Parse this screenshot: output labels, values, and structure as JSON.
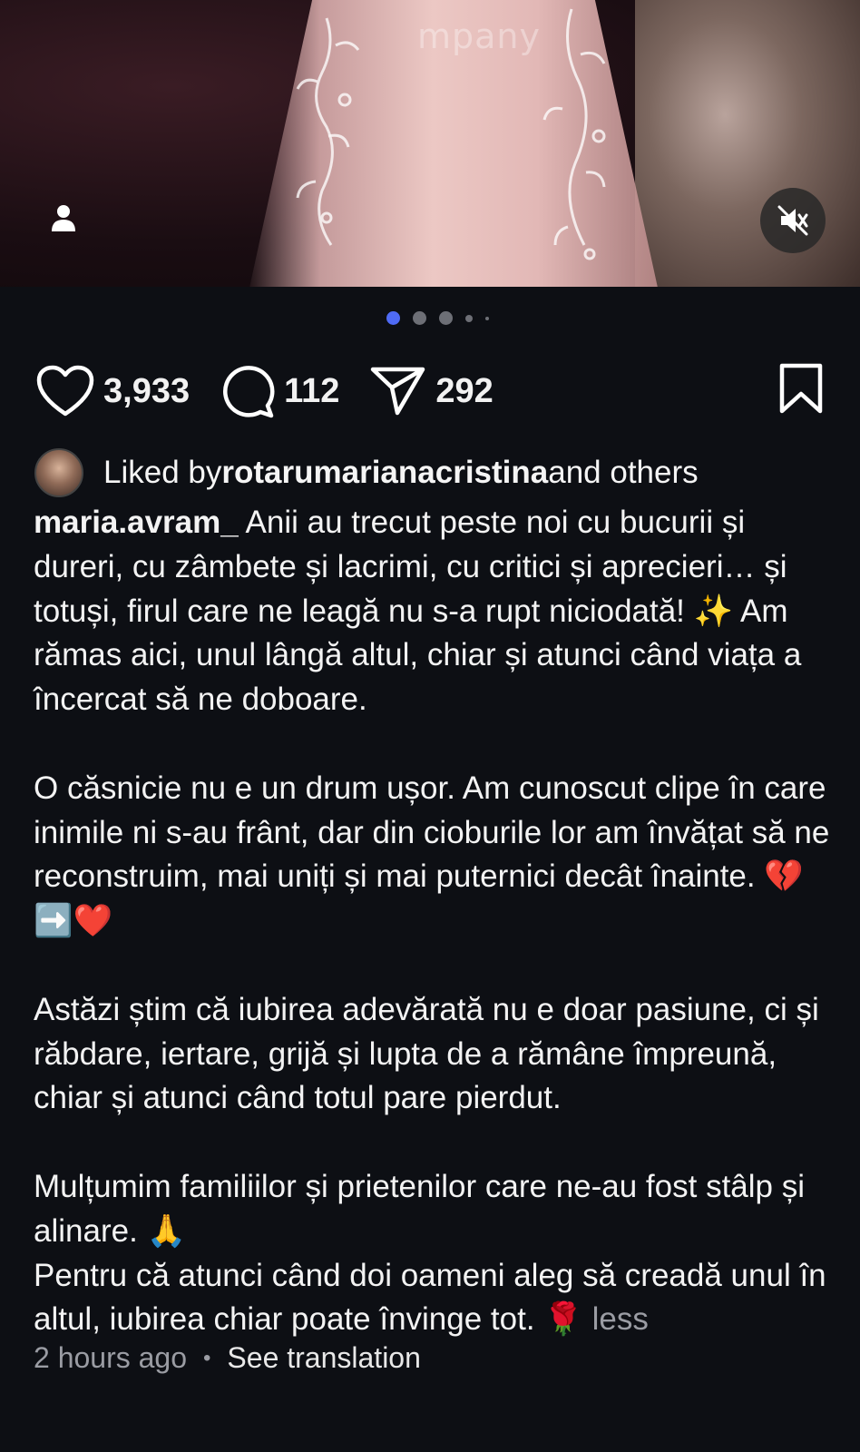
{
  "media": {
    "watermark": "mpany",
    "carousel_count": 5,
    "carousel_active_index": 0
  },
  "actions": {
    "likes": "3,933",
    "comments": "112",
    "shares": "292"
  },
  "liked_by": {
    "prefix": "Liked by ",
    "user": "rotarumarianacristina",
    "suffix": " and others"
  },
  "caption": {
    "username": "maria.avram_",
    "p1": " Anii au trecut peste noi cu bucurii și dureri, cu zâmbete și lacrimi, cu critici și aprecieri… și totuși, firul care ne leagă nu s-a rupt niciodată! ✨ Am rămas aici, unul lângă altul, chiar și atunci când viața a încercat să ne doboare.",
    "p2": "O căsnicie nu e un drum ușor. Am cunoscut clipe în care inimile ni s-au frânt, dar din cioburile lor am învățat să ne reconstruim, mai uniți și mai puternici decât înainte. 💔➡️❤️",
    "p3": "Astăzi știm că iubirea adevărată nu e doar pasiune, ci și răbdare, iertare, grijă și lupta de a rămâne împreună, chiar și atunci când totul pare pierdut.",
    "p4a": "Mulțumim familiilor și prietenilor care ne-au fost stâlp și alinare. 🙏",
    "p4b": "Pentru că atunci când doi oameni aleg să creadă unul în altul, iubirea chiar poate învinge tot. 🌹 ",
    "less": "less"
  },
  "meta": {
    "time": "2 hours ago",
    "separator": "•",
    "translate": "See translation"
  }
}
